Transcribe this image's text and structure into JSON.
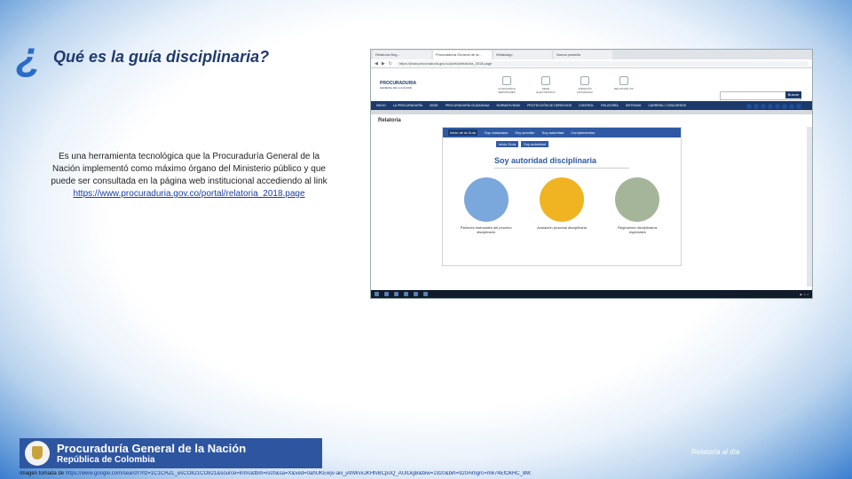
{
  "slide": {
    "question_mark": "¿",
    "title": "Qué es la guía disciplinaria?",
    "body": "Es una herramienta tecnológica que la Procuraduría General de la Nación implementó como máximo órgano del Ministerio público y que puede ser consultada en la página web institucional accediendo al link",
    "link": "https://www.procuraduria.gov.co/portal/relatoria_2018.page"
  },
  "screenshot": {
    "tabs": [
      "Relatoría Bog...",
      "Procuraduría General de la...",
      "WhatsApp",
      "Nueva pestaña"
    ],
    "url": "https://www.procuraduria.gov.co/portal/relatoria_2018.page",
    "site_logo_line1": "PROCURADURIA",
    "site_logo_line2": "GENERAL DE LA NACION",
    "quick_links": [
      "CONCURSOS SERVIDORES",
      "SEDE ELECTRÓNICA",
      "ATENCIÓN CIUDADANA",
      "RELATORÍA TIC"
    ],
    "search_button": "Buscar",
    "main_nav": [
      "INICIO",
      "LA PROCURADURÍA",
      "SEDE",
      "PROCURADURÍA CIUDADANA",
      "NORMATIVIDAD",
      "PROTECCIÓN DE DERECHOS",
      "CONTROL",
      "RELATORÍA",
      "SISTEMAS",
      "CARRERA / CONCURSOS"
    ],
    "page_title": "Relatoría",
    "subnav": [
      "Inicio de la Guía",
      "Soy ciudadano",
      "Soy servidor",
      "Soy autoridad",
      "Complementos"
    ],
    "subnav_selected_index": 0,
    "subtabs": [
      "Inicio Guía",
      "Soy autoridad"
    ],
    "big_title": "Soy autoridad disciplinaria",
    "cards": [
      {
        "caption": "Patrones esenciales del proceso disciplinario",
        "color": "#7aa7dc"
      },
      {
        "caption": "Actuación procesal disciplinaria",
        "color": "#f0b322"
      },
      {
        "caption": "Regímenes disciplinarios especiales",
        "color": "#a5b59a"
      }
    ]
  },
  "footer": {
    "org_line1": "Procuraduría General de la Nación",
    "org_line2": "República de Colombia",
    "relatoria": "Relatoría al día",
    "credit_label": "Imagen tomada de",
    "credit_url": "https://www.google.com/search?rlz=1C1CHZL_esCO821CO821&source=lnms&tbm=isch&sa=X&ved=0ahUKEwjv-aiii_jAhWvxJKHfvBCpoQ_AUIDigB&biw=1920&bih=920#imgrc=m674EfOkHC_8M:"
  }
}
